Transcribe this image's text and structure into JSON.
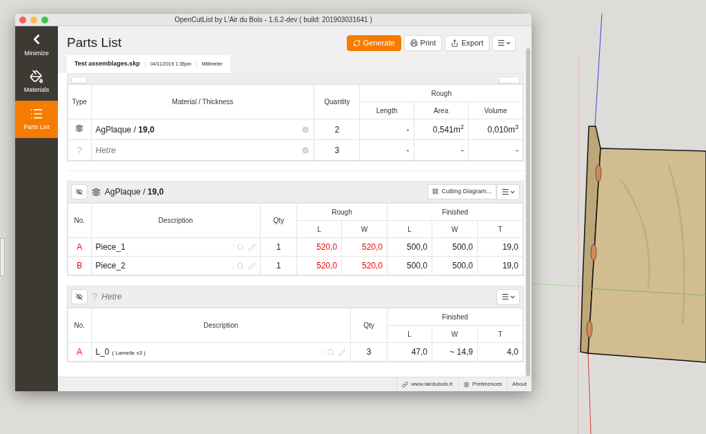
{
  "window": {
    "title": "OpenCutList by L'Air du Bois - 1.6.2-dev ( build: 201903031641 )"
  },
  "sidebar": {
    "items": [
      {
        "label": "Minimize",
        "kind": "minimize",
        "selected": false
      },
      {
        "label": "Materials",
        "kind": "materials",
        "selected": false
      },
      {
        "label": "Parts List",
        "kind": "parts",
        "selected": true
      }
    ]
  },
  "header": {
    "title": "Parts List",
    "buttons": [
      {
        "label": "Generate",
        "kind": "generate"
      },
      {
        "label": "Print",
        "kind": "print"
      },
      {
        "label": "Export",
        "kind": "export"
      },
      {
        "kind": "menu"
      }
    ]
  },
  "file_tab": {
    "name": "Test assemblages.skp",
    "date": "04/11/2019 1:35pm",
    "unit": "Millimeter"
  },
  "summary": {
    "columns": [
      {
        "label": "Type"
      },
      {
        "label": "Material / Thickness"
      },
      {
        "label": "Quantity"
      }
    ],
    "groups": [
      {
        "label": "Rough",
        "columns": [
          {
            "label": "Length"
          },
          {
            "label": "Area"
          },
          {
            "label": "Volume"
          }
        ]
      }
    ],
    "rows": [
      {
        "kind": "sheet",
        "material": "AgPlaque / **19,0**",
        "qty": "2",
        "values": [
          "-",
          "0,541m$^{2}$",
          "0,010m$^{3}$"
        ]
      },
      {
        "kind": "unknown",
        "symbol": "?",
        "material": "Hetre",
        "qty": "3",
        "values": [
          "-",
          "-",
          "-"
        ]
      }
    ]
  },
  "groups": [
    {
      "kind": "sheet",
      "title": "AgPlaque / **19,0**",
      "diagram_button": "Cutting Diagram...",
      "columns": [
        {
          "label": "No."
        },
        {
          "label": "Description"
        },
        {
          "label": "Qty"
        }
      ],
      "groups": [
        {
          "label": "Rough",
          "columns": [
            {
              "label": "L"
            },
            {
              "label": "W"
            }
          ]
        },
        {
          "label": "Finished",
          "columns": [
            {
              "label": "L"
            },
            {
              "label": "W"
            },
            {
              "label": "T"
            }
          ]
        }
      ],
      "rows": [
        {
          "no": "A",
          "name": "Piece_1",
          "qty": "1",
          "values": [
            [
              "520,0",
              "520,0"
            ],
            [
              "500,0",
              "500,0",
              "19,0"
            ]
          ]
        },
        {
          "no": "B",
          "name": "Piece_2",
          "qty": "1",
          "values": [
            [
              "520,0",
              "520,0"
            ],
            [
              "500,0",
              "500,0",
              "19,0"
            ]
          ]
        }
      ]
    },
    {
      "kind": "unknown",
      "symbol": "?",
      "title": "Hetre",
      "columns": [
        {
          "label": "No."
        },
        {
          "label": "Description"
        },
        {
          "label": "Qty"
        }
      ],
      "groups": [
        {
          "label": "Finished",
          "columns": [
            {
              "label": "L"
            },
            {
              "label": "W"
            },
            {
              "label": "T"
            }
          ]
        }
      ],
      "rows": [
        {
          "no": "A",
          "name": "L_0",
          "note": "( Lamelle x3 )",
          "qty": "3",
          "values": [
            [
              "47,0",
              "~ 14,9",
              "4,0"
            ]
          ]
        }
      ]
    }
  ],
  "footer": {
    "links": [
      {
        "label": "www.lairdubois.fr",
        "kind": "web"
      },
      {
        "label": "Preferences",
        "kind": "settings"
      },
      {
        "label": "About",
        "kind": "about"
      }
    ]
  }
}
